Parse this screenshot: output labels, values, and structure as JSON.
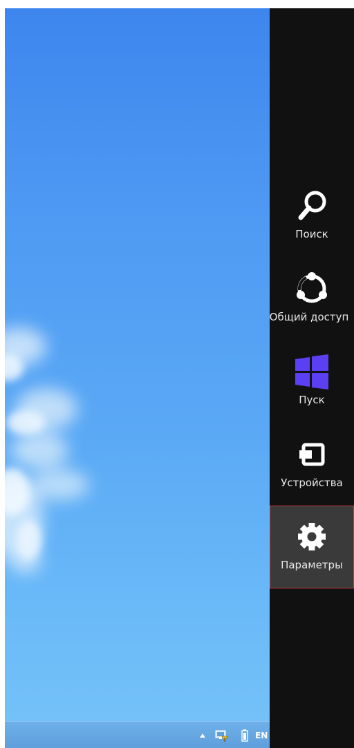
{
  "charms": {
    "search": {
      "label": "Поиск",
      "icon": "search-icon"
    },
    "share": {
      "label": "Общий доступ",
      "icon": "share-icon"
    },
    "start": {
      "label": "Пуск",
      "icon": "windows-logo-icon",
      "color": "#5b3ff2"
    },
    "devices": {
      "label": "Устройства",
      "icon": "devices-icon"
    },
    "settings": {
      "label": "Параметры",
      "icon": "gear-icon",
      "selected": true
    }
  },
  "taskbar": {
    "tray_lang": "EN",
    "icons": [
      "show-hidden-icons-icon",
      "network-icon",
      "battery-icon"
    ]
  },
  "colors": {
    "charms_bg": "#111111",
    "selected_bg": "#3a3a3a",
    "selected_border": "#c23a3a",
    "windows_purple": "#5b3ff2",
    "taskbar": "#5e9fdc",
    "wallpaper": "#4f9af3"
  }
}
